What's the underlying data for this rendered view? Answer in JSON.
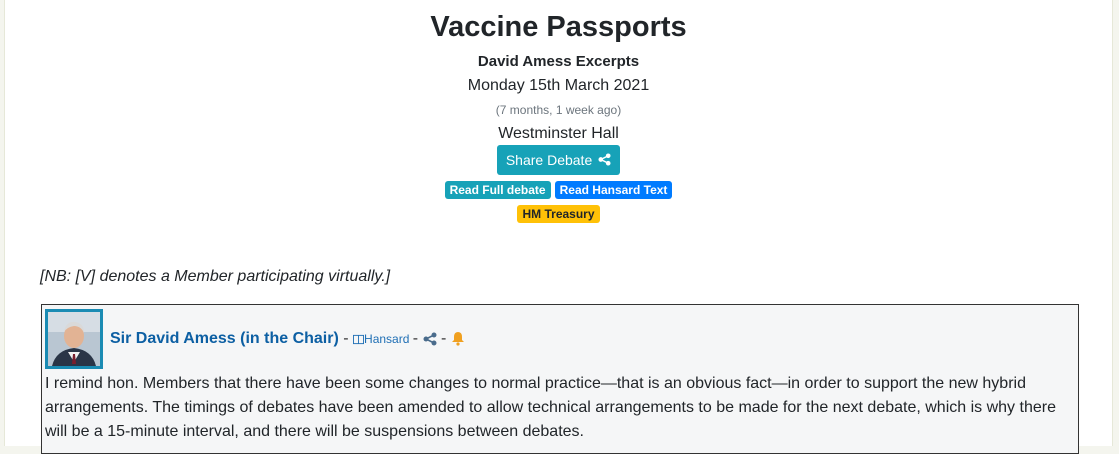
{
  "header": {
    "title": "Vaccine Passports",
    "subtitle": "David Amess Excerpts",
    "date": "Monday 15th March 2021",
    "relative_time": "(7 months, 1 week ago)",
    "venue": "Westminster Hall",
    "share_label": "Share Debate"
  },
  "badges": {
    "read_full": "Read Full debate",
    "read_hansard": "Read Hansard Text",
    "department": "HM Treasury"
  },
  "colors": {
    "teal": "#17a2b8",
    "blue": "#007bff",
    "yellow": "#ffc107",
    "speaker_link": "#0c5fa3",
    "bell": "#f0a020"
  },
  "note": "[NB: [V] denotes a Member participating virtually.]",
  "speech": {
    "speaker": "Sir David Amess (in the Chair)",
    "separator": "-",
    "hansard_label": "Hansard",
    "icons": [
      "book-icon",
      "share-icon",
      "bell-icon"
    ],
    "text": "I remind hon. Members that there have been some changes to normal practice—that is an obvious fact—in order to support the new hybrid arrangements. The timings of debates have been amended to allow technical arrangements to be made for the next debate, which is why there will be a 15-minute interval, and there will be suspensions between debates."
  }
}
